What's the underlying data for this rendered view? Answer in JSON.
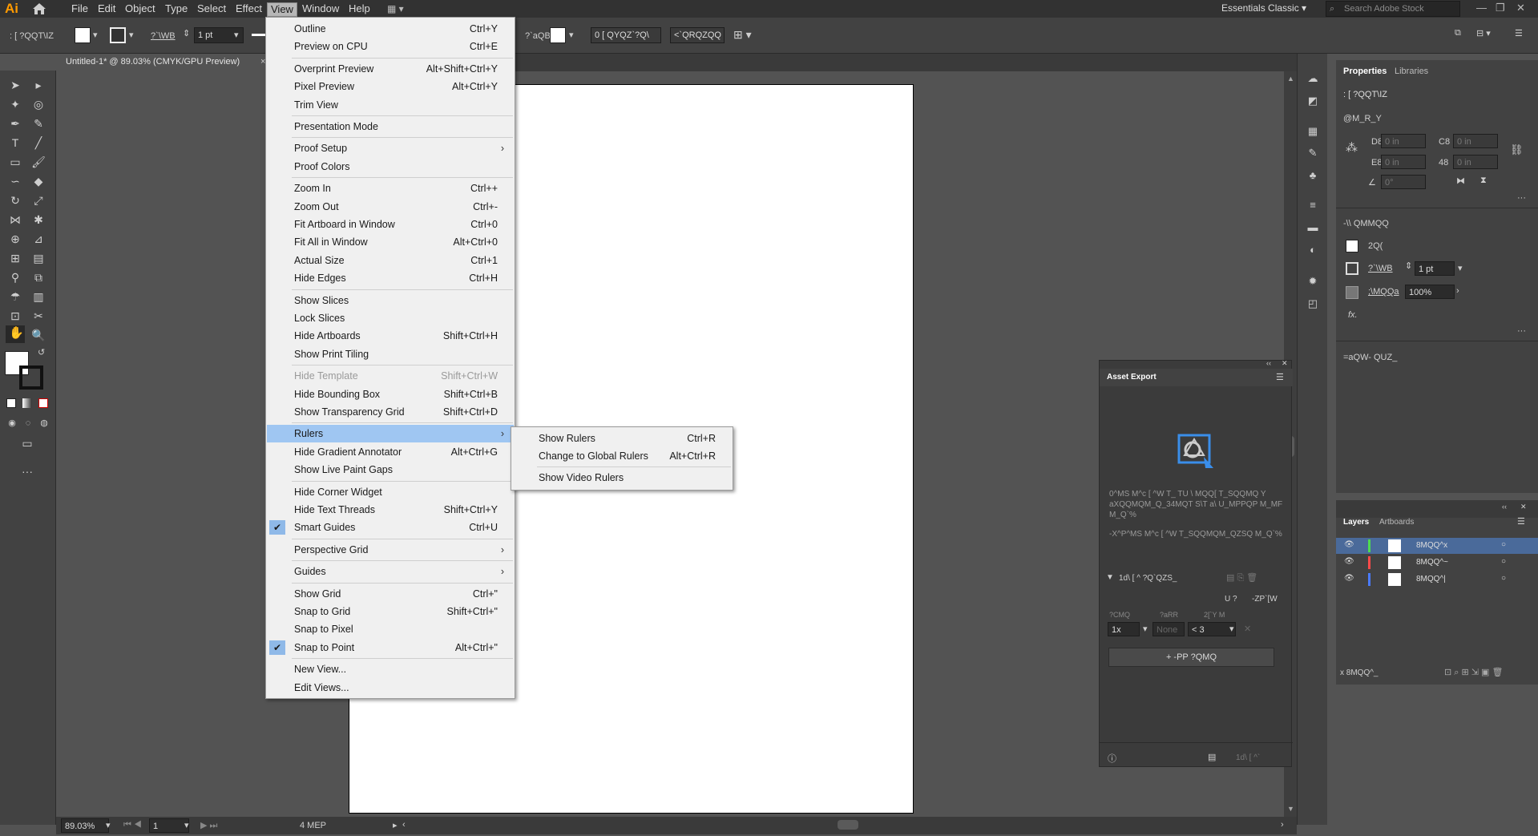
{
  "app": {
    "logo": "Ai"
  },
  "menubar": {
    "items": [
      "File",
      "Edit",
      "Object",
      "Type",
      "Select",
      "Effect",
      "View",
      "Window",
      "Help"
    ],
    "active": "View",
    "workspace": "Essentials Classic",
    "search_placeholder": "Search Adobe Stock"
  },
  "controlbar": {
    "selection_label": ": [ ?QQT\\IZ",
    "stroke_label": "?`\\WB",
    "stroke_value": "1 pt",
    "opacity_label": "?`aQB",
    "doc_setup": "0 [ QYQZ`?Q\\",
    "prefs": "<`QRQZQQ"
  },
  "document": {
    "tab_title": "Untitled-1* @ 89.03% (CMYK/GPU Preview)"
  },
  "statusbar": {
    "zoom": "89.03%",
    "artboard": "1",
    "tool": "4 MEP"
  },
  "properties_panel": {
    "tabs": [
      "Properties",
      "Libraries"
    ],
    "selection": ": [ ?QQT\\IZ",
    "transform": "@M_R_Y",
    "x_label": "D8",
    "x_value": "0 in",
    "y_label": "E8",
    "y_value": "0 in",
    "w_label": "C8",
    "w_value": "0 in",
    "h_label": "48",
    "h_value": "0 in",
    "angle_value": "0°",
    "appearance": "-\\\\ QMMQQ",
    "fill_label": "2Q(",
    "stroke_label": "?`\\WB",
    "stroke_value": "1 pt",
    "opacity_label": ";\\MQQa",
    "opacity_value": "100%",
    "fx": "fx.",
    "align": "=aQW- QUZ_"
  },
  "asset_export": {
    "title": "Asset Export",
    "desc1": "0^MS M^c [ ^W T_ TU \\ MQQ[ T_SQQMQ Y aXQQMQM_Q_34MQT S\\T a\\ U_MPPQP M_MF M_Q`%",
    "desc2": "-X^P^MS M^c [ ^W T_SQQMQM_QZSQ M_Q`%",
    "section": "1d\\ [ ^ ?Q`QZS_",
    "ios": "U ?",
    "android": "-ZP`[W",
    "col_scale": "?CMQ",
    "col_suffix": "?aRR",
    "col_format": "2[`Y M",
    "scale_value": "1x",
    "suffix_value": "None",
    "format_value": "< 3",
    "add_scale": "+ -PP ?QMQ",
    "export_btn": "1d\\ [ ^`"
  },
  "layers_panel": {
    "tabs": [
      "Layers",
      "Artboards"
    ],
    "rows": [
      {
        "name": "8MQQ^x",
        "color": "#4fdb4f"
      },
      {
        "name": "8MQQ^~",
        "color": "#ff4a4a"
      },
      {
        "name": "8MQQ^|",
        "color": "#4a7bff"
      }
    ],
    "footer": "x 8MQQ^_"
  },
  "view_menu": {
    "items": [
      {
        "label": "Outline",
        "shortcut": "Ctrl+Y"
      },
      {
        "label": "Preview on CPU",
        "shortcut": "Ctrl+E"
      },
      {
        "sep": true
      },
      {
        "label": "Overprint Preview",
        "shortcut": "Alt+Shift+Ctrl+Y"
      },
      {
        "label": "Pixel Preview",
        "shortcut": "Alt+Ctrl+Y"
      },
      {
        "label": "Trim View",
        "shortcut": ""
      },
      {
        "sep": true
      },
      {
        "label": "Presentation Mode",
        "shortcut": ""
      },
      {
        "sep": true
      },
      {
        "label": "Proof Setup",
        "shortcut": "",
        "submenu": true
      },
      {
        "label": "Proof Colors",
        "shortcut": ""
      },
      {
        "sep": true
      },
      {
        "label": "Zoom In",
        "shortcut": "Ctrl++"
      },
      {
        "label": "Zoom Out",
        "shortcut": "Ctrl+-"
      },
      {
        "label": "Fit Artboard in Window",
        "shortcut": "Ctrl+0"
      },
      {
        "label": "Fit All in Window",
        "shortcut": "Alt+Ctrl+0"
      },
      {
        "label": "Actual Size",
        "shortcut": "Ctrl+1"
      },
      {
        "label": "Hide Edges",
        "shortcut": "Ctrl+H"
      },
      {
        "sep": true
      },
      {
        "label": "Show Slices",
        "shortcut": ""
      },
      {
        "label": "Lock Slices",
        "shortcut": ""
      },
      {
        "label": "Hide Artboards",
        "shortcut": "Shift+Ctrl+H"
      },
      {
        "label": "Show Print Tiling",
        "shortcut": ""
      },
      {
        "sep": true
      },
      {
        "label": "Hide Template",
        "shortcut": "Shift+Ctrl+W",
        "disabled": true
      },
      {
        "label": "Hide Bounding Box",
        "shortcut": "Shift+Ctrl+B"
      },
      {
        "label": "Show Transparency Grid",
        "shortcut": "Shift+Ctrl+D"
      },
      {
        "sep": true
      },
      {
        "label": "Rulers",
        "shortcut": "",
        "submenu": true,
        "highlighted": true
      },
      {
        "label": "Hide Gradient Annotator",
        "shortcut": "Alt+Ctrl+G"
      },
      {
        "label": "Show Live Paint Gaps",
        "shortcut": ""
      },
      {
        "sep": true
      },
      {
        "label": "Hide Corner Widget",
        "shortcut": ""
      },
      {
        "label": "Hide Text Threads",
        "shortcut": "Shift+Ctrl+Y"
      },
      {
        "label": "Smart Guides",
        "shortcut": "Ctrl+U",
        "checked": true
      },
      {
        "sep": true
      },
      {
        "label": "Perspective Grid",
        "shortcut": "",
        "submenu": true
      },
      {
        "sep": true
      },
      {
        "label": "Guides",
        "shortcut": "",
        "submenu": true
      },
      {
        "sep": true
      },
      {
        "label": "Show Grid",
        "shortcut": "Ctrl+\""
      },
      {
        "label": "Snap to Grid",
        "shortcut": "Shift+Ctrl+\""
      },
      {
        "label": "Snap to Pixel",
        "shortcut": ""
      },
      {
        "label": "Snap to Point",
        "shortcut": "Alt+Ctrl+\"",
        "checked": true
      },
      {
        "sep": true
      },
      {
        "label": "New View...",
        "shortcut": ""
      },
      {
        "label": "Edit Views...",
        "shortcut": ""
      }
    ]
  },
  "rulers_submenu": {
    "items": [
      {
        "label": "Show Rulers",
        "shortcut": "Ctrl+R"
      },
      {
        "label": "Change to Global Rulers",
        "shortcut": "Alt+Ctrl+R"
      },
      {
        "sep": true
      },
      {
        "label": "Show Video Rulers",
        "shortcut": ""
      }
    ]
  }
}
